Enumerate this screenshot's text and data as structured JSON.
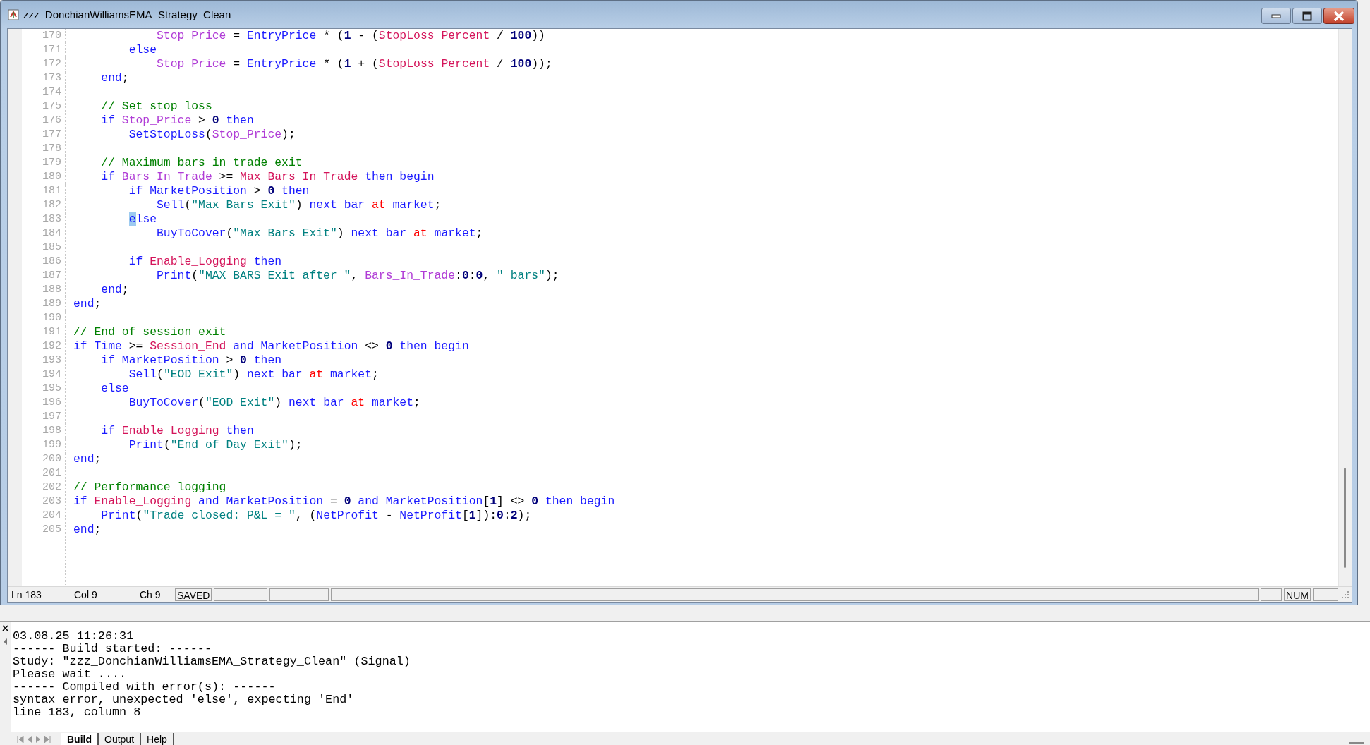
{
  "window": {
    "title": "zzz_DonchianWilliamsEMA_Strategy_Clean"
  },
  "editor": {
    "lines": [
      {
        "number": "170",
        "tokens": [
          {
            "text": "            Stop_Price",
            "kind": "var"
          },
          {
            "text": " = ",
            "kind": "plain"
          },
          {
            "text": "EntryPrice",
            "kind": "keyword"
          },
          {
            "text": " * (",
            "kind": "plain"
          },
          {
            "text": "1",
            "kind": "number"
          },
          {
            "text": " - (",
            "kind": "plain"
          },
          {
            "text": "StopLoss_Percent",
            "kind": "input"
          },
          {
            "text": " / ",
            "kind": "plain"
          },
          {
            "text": "100",
            "kind": "number"
          },
          {
            "text": "))",
            "kind": "plain"
          }
        ]
      },
      {
        "number": "171",
        "tokens": [
          {
            "text": "        else",
            "kind": "keyword"
          }
        ]
      },
      {
        "number": "172",
        "tokens": [
          {
            "text": "            Stop_Price",
            "kind": "var"
          },
          {
            "text": " = ",
            "kind": "plain"
          },
          {
            "text": "EntryPrice",
            "kind": "keyword"
          },
          {
            "text": " * (",
            "kind": "plain"
          },
          {
            "text": "1",
            "kind": "number"
          },
          {
            "text": " + (",
            "kind": "plain"
          },
          {
            "text": "StopLoss_Percent",
            "kind": "input"
          },
          {
            "text": " / ",
            "kind": "plain"
          },
          {
            "text": "100",
            "kind": "number"
          },
          {
            "text": "));",
            "kind": "plain"
          }
        ]
      },
      {
        "number": "173",
        "tokens": [
          {
            "text": "    end",
            "kind": "keyword"
          },
          {
            "text": ";",
            "kind": "plain"
          }
        ]
      },
      {
        "number": "174"
      },
      {
        "number": "175",
        "tokens": [
          {
            "text": "    // Set stop loss",
            "kind": "comment"
          }
        ]
      },
      {
        "number": "176",
        "tokens": [
          {
            "text": "    if ",
            "kind": "keyword"
          },
          {
            "text": "Stop_Price",
            "kind": "var"
          },
          {
            "text": " > ",
            "kind": "plain"
          },
          {
            "text": "0",
            "kind": "number"
          },
          {
            "text": " then",
            "kind": "keyword"
          }
        ]
      },
      {
        "number": "177",
        "tokens": [
          {
            "text": "        SetStopLoss",
            "kind": "keyword"
          },
          {
            "text": "(",
            "kind": "plain"
          },
          {
            "text": "Stop_Price",
            "kind": "var"
          },
          {
            "text": ");",
            "kind": "plain"
          }
        ]
      },
      {
        "number": "178"
      },
      {
        "number": "179",
        "tokens": [
          {
            "text": "    // Maximum bars in trade exit",
            "kind": "comment"
          }
        ]
      },
      {
        "number": "180",
        "tokens": [
          {
            "text": "    if ",
            "kind": "keyword"
          },
          {
            "text": "Bars_In_Trade",
            "kind": "var"
          },
          {
            "text": " >= ",
            "kind": "plain"
          },
          {
            "text": "Max_Bars_In_Trade",
            "kind": "input"
          },
          {
            "text": " then begin",
            "kind": "keyword"
          }
        ]
      },
      {
        "number": "181",
        "tokens": [
          {
            "text": "        if MarketPosition",
            "kind": "keyword"
          },
          {
            "text": " > ",
            "kind": "plain"
          },
          {
            "text": "0",
            "kind": "number"
          },
          {
            "text": " then",
            "kind": "keyword"
          }
        ]
      },
      {
        "number": "182",
        "tokens": [
          {
            "text": "            Sell",
            "kind": "keyword"
          },
          {
            "text": "(",
            "kind": "plain"
          },
          {
            "text": "\"Max Bars Exit\"",
            "kind": "string"
          },
          {
            "text": ") ",
            "kind": "plain"
          },
          {
            "text": "next bar ",
            "kind": "keyword"
          },
          {
            "text": "at",
            "kind": "reserved"
          },
          {
            "text": " market",
            "kind": "keyword"
          },
          {
            "text": ";",
            "kind": "plain"
          }
        ]
      },
      {
        "number": "183",
        "tokens": [
          {
            "text": "        e",
            "kind": "cursor"
          },
          {
            "text": "lse",
            "kind": "keyword"
          }
        ]
      },
      {
        "number": "184",
        "tokens": [
          {
            "text": "            BuyToCover",
            "kind": "keyword"
          },
          {
            "text": "(",
            "kind": "plain"
          },
          {
            "text": "\"Max Bars Exit\"",
            "kind": "string"
          },
          {
            "text": ") ",
            "kind": "plain"
          },
          {
            "text": "next bar ",
            "kind": "keyword"
          },
          {
            "text": "at",
            "kind": "reserved"
          },
          {
            "text": " market",
            "kind": "keyword"
          },
          {
            "text": ";",
            "kind": "plain"
          }
        ]
      },
      {
        "number": "185"
      },
      {
        "number": "186",
        "tokens": [
          {
            "text": "        if ",
            "kind": "keyword"
          },
          {
            "text": "Enable_Logging",
            "kind": "input"
          },
          {
            "text": " then",
            "kind": "keyword"
          }
        ]
      },
      {
        "number": "187",
        "tokens": [
          {
            "text": "            Print",
            "kind": "keyword"
          },
          {
            "text": "(",
            "kind": "plain"
          },
          {
            "text": "\"MAX BARS Exit after \"",
            "kind": "string"
          },
          {
            "text": ", ",
            "kind": "plain"
          },
          {
            "text": "Bars_In_Trade",
            "kind": "var"
          },
          {
            "text": ":",
            "kind": "plain"
          },
          {
            "text": "0",
            "kind": "number"
          },
          {
            "text": ":",
            "kind": "plain"
          },
          {
            "text": "0",
            "kind": "number"
          },
          {
            "text": ", ",
            "kind": "plain"
          },
          {
            "text": "\" bars\"",
            "kind": "string"
          },
          {
            "text": ");",
            "kind": "plain"
          }
        ]
      },
      {
        "number": "188",
        "tokens": [
          {
            "text": "    end",
            "kind": "keyword"
          },
          {
            "text": ";",
            "kind": "plain"
          }
        ]
      },
      {
        "number": "189",
        "tokens": [
          {
            "text": "end",
            "kind": "keyword"
          },
          {
            "text": ";",
            "kind": "plain"
          }
        ]
      },
      {
        "number": "190"
      },
      {
        "number": "191",
        "tokens": [
          {
            "text": "// End of session exit",
            "kind": "comment"
          }
        ]
      },
      {
        "number": "192",
        "tokens": [
          {
            "text": "if Time",
            "kind": "keyword"
          },
          {
            "text": " >= ",
            "kind": "plain"
          },
          {
            "text": "Session_End",
            "kind": "input"
          },
          {
            "text": " and MarketPosition",
            "kind": "keyword"
          },
          {
            "text": " <> ",
            "kind": "plain"
          },
          {
            "text": "0",
            "kind": "number"
          },
          {
            "text": " then begin",
            "kind": "keyword"
          }
        ]
      },
      {
        "number": "193",
        "tokens": [
          {
            "text": "    if MarketPosition",
            "kind": "keyword"
          },
          {
            "text": " > ",
            "kind": "plain"
          },
          {
            "text": "0",
            "kind": "number"
          },
          {
            "text": " then",
            "kind": "keyword"
          }
        ]
      },
      {
        "number": "194",
        "tokens": [
          {
            "text": "        Sell",
            "kind": "keyword"
          },
          {
            "text": "(",
            "kind": "plain"
          },
          {
            "text": "\"EOD Exit\"",
            "kind": "string"
          },
          {
            "text": ") ",
            "kind": "plain"
          },
          {
            "text": "next bar ",
            "kind": "keyword"
          },
          {
            "text": "at",
            "kind": "reserved"
          },
          {
            "text": " market",
            "kind": "keyword"
          },
          {
            "text": ";",
            "kind": "plain"
          }
        ]
      },
      {
        "number": "195",
        "tokens": [
          {
            "text": "    else",
            "kind": "keyword"
          }
        ]
      },
      {
        "number": "196",
        "tokens": [
          {
            "text": "        BuyToCover",
            "kind": "keyword"
          },
          {
            "text": "(",
            "kind": "plain"
          },
          {
            "text": "\"EOD Exit\"",
            "kind": "string"
          },
          {
            "text": ") ",
            "kind": "plain"
          },
          {
            "text": "next bar ",
            "kind": "keyword"
          },
          {
            "text": "at",
            "kind": "reserved"
          },
          {
            "text": " market",
            "kind": "keyword"
          },
          {
            "text": ";",
            "kind": "plain"
          }
        ]
      },
      {
        "number": "197"
      },
      {
        "number": "198",
        "tokens": [
          {
            "text": "    if ",
            "kind": "keyword"
          },
          {
            "text": "Enable_Logging",
            "kind": "input"
          },
          {
            "text": " then",
            "kind": "keyword"
          }
        ]
      },
      {
        "number": "199",
        "tokens": [
          {
            "text": "        Print",
            "kind": "keyword"
          },
          {
            "text": "(",
            "kind": "plain"
          },
          {
            "text": "\"End of Day Exit\"",
            "kind": "string"
          },
          {
            "text": ");",
            "kind": "plain"
          }
        ]
      },
      {
        "number": "200",
        "tokens": [
          {
            "text": "end",
            "kind": "keyword"
          },
          {
            "text": ";",
            "kind": "plain"
          }
        ]
      },
      {
        "number": "201"
      },
      {
        "number": "202",
        "tokens": [
          {
            "text": "// Performance logging",
            "kind": "comment"
          }
        ]
      },
      {
        "number": "203",
        "tokens": [
          {
            "text": "if ",
            "kind": "keyword"
          },
          {
            "text": "Enable_Logging",
            "kind": "input"
          },
          {
            "text": " and MarketPosition",
            "kind": "keyword"
          },
          {
            "text": " = ",
            "kind": "plain"
          },
          {
            "text": "0",
            "kind": "number"
          },
          {
            "text": " and MarketPosition",
            "kind": "keyword"
          },
          {
            "text": "[",
            "kind": "plain"
          },
          {
            "text": "1",
            "kind": "number"
          },
          {
            "text": "] <> ",
            "kind": "plain"
          },
          {
            "text": "0",
            "kind": "number"
          },
          {
            "text": " then begin",
            "kind": "keyword"
          }
        ]
      },
      {
        "number": "204",
        "tokens": [
          {
            "text": "    Print",
            "kind": "keyword"
          },
          {
            "text": "(",
            "kind": "plain"
          },
          {
            "text": "\"Trade closed: P&L = \"",
            "kind": "string"
          },
          {
            "text": ", (",
            "kind": "plain"
          },
          {
            "text": "NetProfit",
            "kind": "keyword"
          },
          {
            "text": " - ",
            "kind": "plain"
          },
          {
            "text": "NetProfit",
            "kind": "keyword"
          },
          {
            "text": "[",
            "kind": "plain"
          },
          {
            "text": "1",
            "kind": "number"
          },
          {
            "text": "]):",
            "kind": "plain"
          },
          {
            "text": "0",
            "kind": "number"
          },
          {
            "text": ":",
            "kind": "plain"
          },
          {
            "text": "2",
            "kind": "number"
          },
          {
            "text": ");",
            "kind": "plain"
          }
        ]
      },
      {
        "number": "205",
        "tokens": [
          {
            "text": "end",
            "kind": "keyword"
          },
          {
            "text": ";",
            "kind": "plain"
          }
        ]
      }
    ]
  },
  "status_bar": {
    "panels": [
      {
        "kind": "text",
        "text": "Ln 183"
      },
      {
        "kind": "text",
        "text": "Col 9"
      },
      {
        "kind": "text",
        "text": "Ch 9"
      },
      {
        "kind": "box",
        "text": "SAVED"
      },
      {
        "kind": "blank"
      },
      {
        "kind": "blank"
      },
      {
        "kind": "fill"
      },
      {
        "kind": "blank"
      },
      {
        "kind": "box",
        "text": "NUM"
      },
      {
        "kind": "blank"
      }
    ]
  },
  "output": {
    "lines": [
      "03.08.25 11:26:31",
      "------ Build started: ------",
      "Study: \"zzz_DonchianWilliamsEMA_Strategy_Clean\" (Signal)",
      "Please wait ....",
      "------ Compiled with error(s): ------",
      "syntax error, unexpected 'else', expecting 'End'",
      "line 183, column 8"
    ],
    "tabs": [
      {
        "label": "Build",
        "selected": true
      },
      {
        "label": "Output",
        "selected": false
      },
      {
        "label": "Help",
        "selected": false
      }
    ]
  }
}
